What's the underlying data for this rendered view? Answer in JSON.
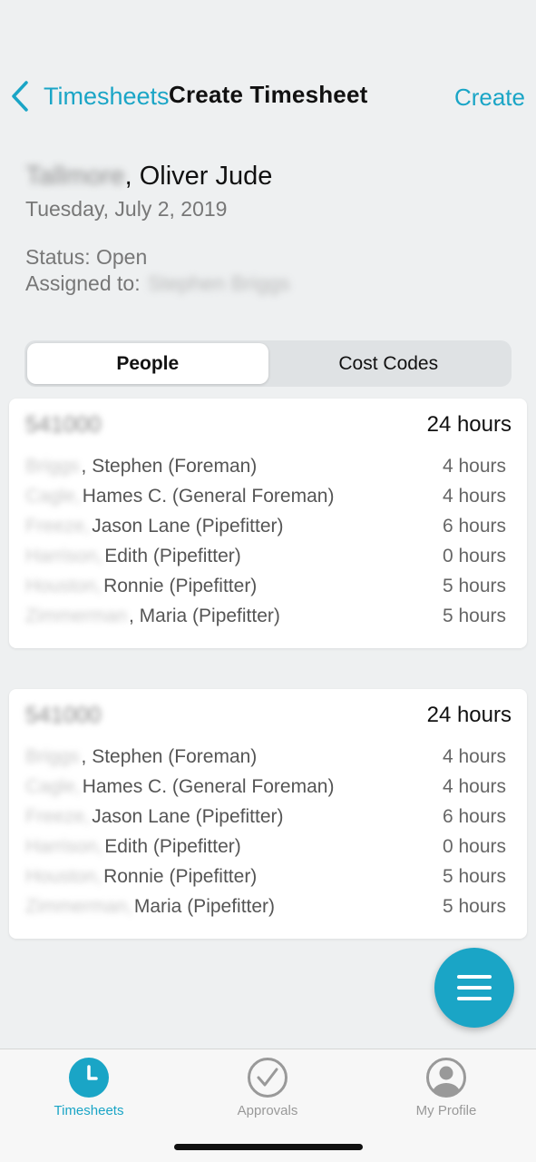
{
  "nav": {
    "back_label": "Timesheets",
    "title": "Create Timesheet",
    "action_label": "Create"
  },
  "header": {
    "last_name": "Tallmore",
    "first_name": ", Oliver Jude",
    "date": "Tuesday, July 2, 2019",
    "status": "Status: Open",
    "assigned_label": "Assigned to:",
    "assigned_name": "Stephen Briggs"
  },
  "segments": [
    {
      "label": "People",
      "active": true
    },
    {
      "label": "Cost Codes",
      "active": false
    }
  ],
  "cards": [
    {
      "code": "541000",
      "total": "24 hours",
      "rows": [
        {
          "surname": "Briggs",
          "rest": ", Stephen (Foreman)",
          "hours": "4 hours"
        },
        {
          "surname": "Cagle,",
          "rest": " Hames C. (General Foreman)",
          "hours": "4 hours"
        },
        {
          "surname": "Freeze,",
          "rest": " Jason Lane (Pipefitter)",
          "hours": "6 hours"
        },
        {
          "surname": "Harrison,",
          "rest": " Edith (Pipefitter)",
          "hours": "0 hours"
        },
        {
          "surname": "Houston,",
          "rest": " Ronnie (Pipefitter)",
          "hours": "5 hours"
        },
        {
          "surname": "Zimmerman",
          "rest": ", Maria (Pipefitter)",
          "hours": "5 hours"
        }
      ]
    },
    {
      "code": "541000",
      "total": "24 hours",
      "rows": [
        {
          "surname": "Briggs",
          "rest": ", Stephen (Foreman)",
          "hours": "4 hours"
        },
        {
          "surname": "Cagle,",
          "rest": " Hames C. (General Foreman)",
          "hours": "4 hours"
        },
        {
          "surname": "Freeze,",
          "rest": " Jason Lane (Pipefitter)",
          "hours": "6 hours"
        },
        {
          "surname": "Harrison,",
          "rest": " Edith (Pipefitter)",
          "hours": "0 hours"
        },
        {
          "surname": "Houston,",
          "rest": " Ronnie (Pipefitter)",
          "hours": "5 hours"
        },
        {
          "surname": "Zimmerman,",
          "rest": " Maria (Pipefitter)",
          "hours": "5 hours"
        }
      ]
    }
  ],
  "fab": {
    "icon": "menu-icon"
  },
  "tabbar": [
    {
      "label": "Timesheets",
      "icon": "clock-icon",
      "active": true
    },
    {
      "label": "Approvals",
      "icon": "checkmark-circle-icon",
      "active": false
    },
    {
      "label": "My Profile",
      "icon": "person-circle-icon",
      "active": false
    }
  ],
  "colors": {
    "accent": "#1aa5c6",
    "background": "#eef0f1",
    "muted_text": "#777777"
  }
}
